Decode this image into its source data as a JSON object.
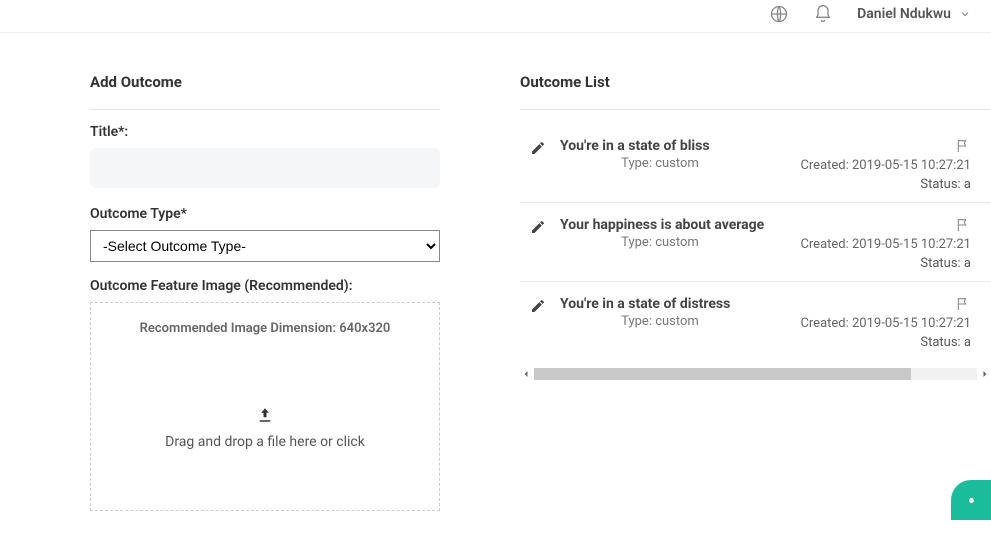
{
  "header": {
    "user_name": "Daniel Ndukwu"
  },
  "add_outcome": {
    "heading": "Add Outcome",
    "title_label": "Title*:",
    "title_value": "",
    "type_label": "Outcome Type*",
    "type_selected": "-Select Outcome Type-",
    "image_label": "Outcome Feature Image (Recommended):",
    "recommended_text": "Recommended Image Dimension: 640x320",
    "upload_text": "Drag and drop a file here or click"
  },
  "outcome_list": {
    "heading": "Outcome List",
    "type_prefix": "Type: ",
    "created_prefix": "Created: ",
    "status_prefix": "Status: ",
    "items": [
      {
        "title": "You're in a state of bliss",
        "type": "custom",
        "created": "2019-05-15 10:27:21",
        "status_suffix": "a"
      },
      {
        "title": "Your happiness is about average",
        "type": "custom",
        "created": "2019-05-15 10:27:21",
        "status_suffix": "a"
      },
      {
        "title": "You're in a state of distress",
        "type": "custom",
        "created": "2019-05-15 10:27:21",
        "status_suffix": "a"
      }
    ]
  }
}
